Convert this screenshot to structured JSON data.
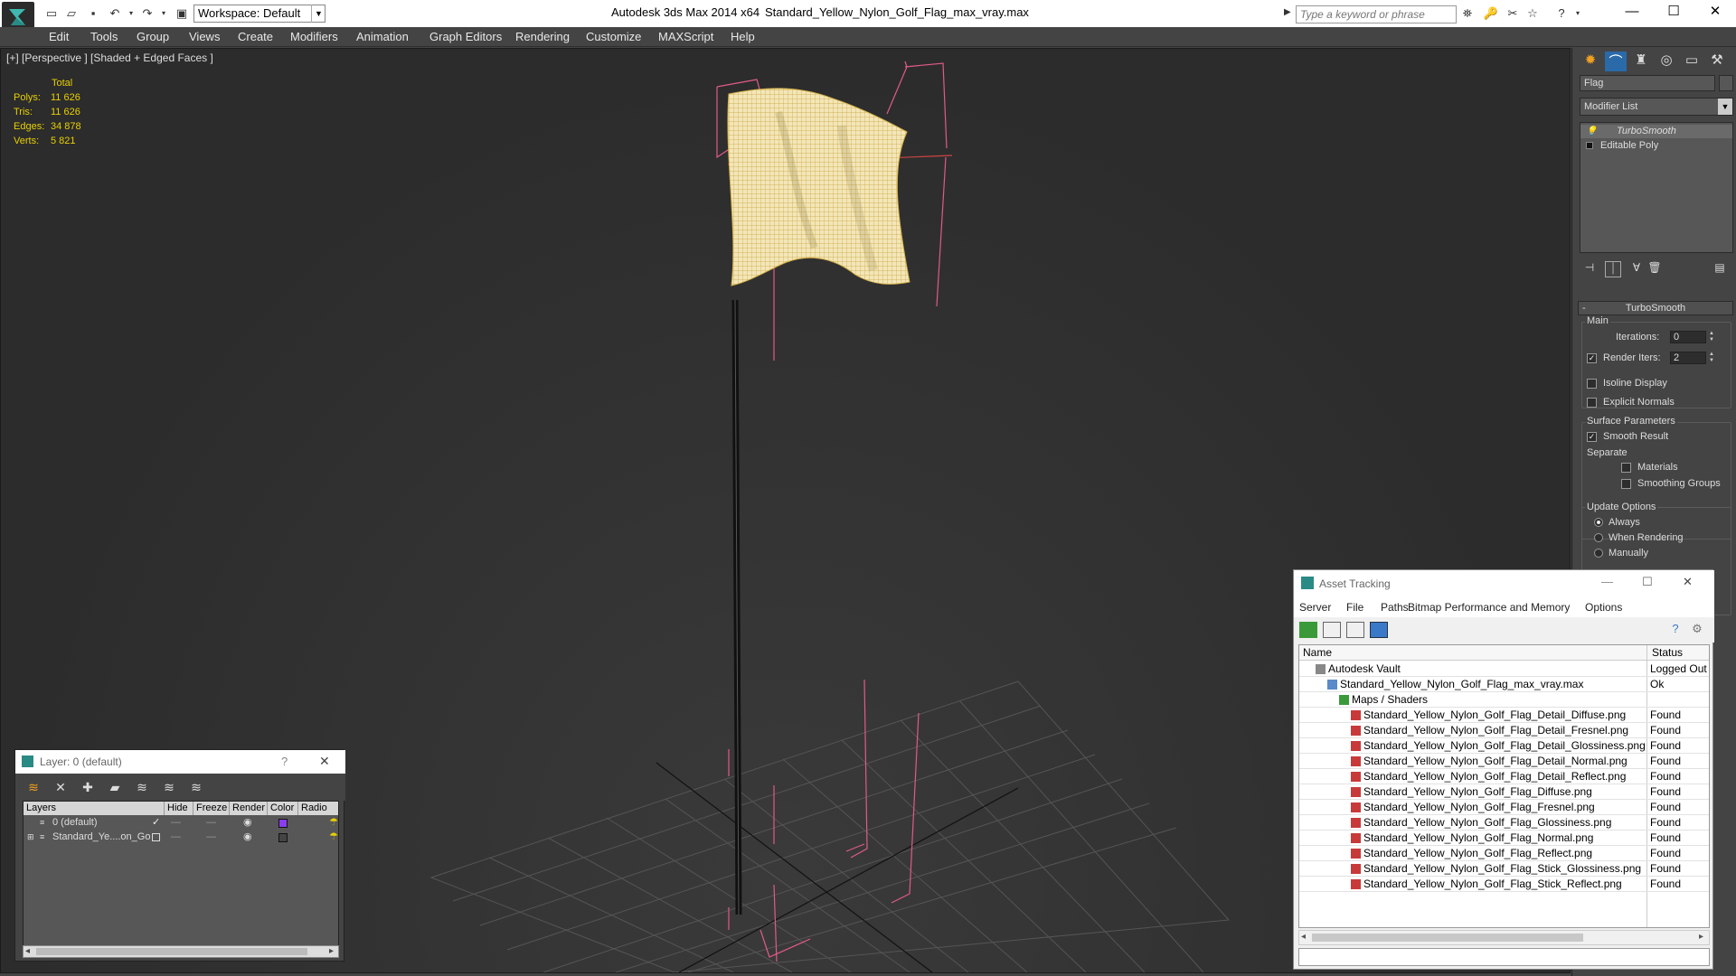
{
  "app": {
    "title": "Autodesk 3ds Max  2014 x64",
    "file": "Standard_Yellow_Nylon_Golf_Flag_max_vray.max",
    "workspace": "Workspace: Default",
    "search_placeholder": "Type a keyword or phrase"
  },
  "menu": [
    "Edit",
    "Tools",
    "Group",
    "Views",
    "Create",
    "Modifiers",
    "Animation",
    "Graph Editors",
    "Rendering",
    "Customize",
    "MAXScript",
    "Help"
  ],
  "viewport": {
    "label": "[+] [Perspective ] [Shaded + Edged Faces ]",
    "stats_header": "Total",
    "stats": [
      {
        "label": "Polys:",
        "value": "11 626"
      },
      {
        "label": "Tris:",
        "value": "11 626"
      },
      {
        "label": "Edges:",
        "value": "34 878"
      },
      {
        "label": "Verts:",
        "value": "5 821"
      }
    ]
  },
  "command_panel": {
    "object_name": "Flag",
    "modifier_list": "Modifier List",
    "stack": [
      "TurboSmooth",
      "Editable Poly"
    ],
    "rollout_title": "TurboSmooth",
    "main_label": "Main",
    "iterations_label": "Iterations:",
    "iterations_value": "0",
    "render_iters_label": "Render Iters:",
    "render_iters_value": "2",
    "isoline": "Isoline Display",
    "explicit_normals": "Explicit Normals",
    "surface_params": "Surface Parameters",
    "smooth_result": "Smooth Result",
    "separate": "Separate",
    "materials": "Materials",
    "smoothing_groups": "Smoothing Groups",
    "update_options": "Update Options",
    "always": "Always",
    "when_rendering": "When Rendering",
    "manually": "Manually"
  },
  "asset_tracking": {
    "title": "Asset Tracking",
    "menu": [
      "Server",
      "File",
      "Paths",
      "Bitmap Performance and Memory",
      "Options"
    ],
    "columns": [
      "Name",
      "Status"
    ],
    "rows": [
      {
        "name": "Autodesk Vault",
        "status": "Logged Out",
        "level": 0,
        "icon": "vault-icon"
      },
      {
        "name": "Standard_Yellow_Nylon_Golf_Flag_max_vray.max",
        "status": "Ok",
        "level": 1,
        "icon": "max-file-icon"
      },
      {
        "name": "Maps / Shaders",
        "status": "",
        "level": 2,
        "icon": "maps-icon"
      },
      {
        "name": "Standard_Yellow_Nylon_Golf_Flag_Detail_Diffuse.png",
        "status": "Found",
        "level": 3,
        "icon": "png-icon"
      },
      {
        "name": "Standard_Yellow_Nylon_Golf_Flag_Detail_Fresnel.png",
        "status": "Found",
        "level": 3,
        "icon": "png-icon"
      },
      {
        "name": "Standard_Yellow_Nylon_Golf_Flag_Detail_Glossiness.png",
        "status": "Found",
        "level": 3,
        "icon": "png-icon"
      },
      {
        "name": "Standard_Yellow_Nylon_Golf_Flag_Detail_Normal.png",
        "status": "Found",
        "level": 3,
        "icon": "png-icon"
      },
      {
        "name": "Standard_Yellow_Nylon_Golf_Flag_Detail_Reflect.png",
        "status": "Found",
        "level": 3,
        "icon": "png-icon"
      },
      {
        "name": "Standard_Yellow_Nylon_Golf_Flag_Diffuse.png",
        "status": "Found",
        "level": 3,
        "icon": "png-icon"
      },
      {
        "name": "Standard_Yellow_Nylon_Golf_Flag_Fresnel.png",
        "status": "Found",
        "level": 3,
        "icon": "png-icon"
      },
      {
        "name": "Standard_Yellow_Nylon_Golf_Flag_Glossiness.png",
        "status": "Found",
        "level": 3,
        "icon": "png-icon"
      },
      {
        "name": "Standard_Yellow_Nylon_Golf_Flag_Normal.png",
        "status": "Found",
        "level": 3,
        "icon": "png-icon"
      },
      {
        "name": "Standard_Yellow_Nylon_Golf_Flag_Reflect.png",
        "status": "Found",
        "level": 3,
        "icon": "png-icon"
      },
      {
        "name": "Standard_Yellow_Nylon_Golf_Flag_Stick_Glossiness.png",
        "status": "Found",
        "level": 3,
        "icon": "png-icon"
      },
      {
        "name": "Standard_Yellow_Nylon_Golf_Flag_Stick_Reflect.png",
        "status": "Found",
        "level": 3,
        "icon": "png-icon"
      }
    ]
  },
  "layer_explorer": {
    "title": "Layer: 0 (default)",
    "help": "?",
    "columns": [
      "Layers",
      "Hide",
      "Freeze",
      "Render",
      "Color",
      "Radio"
    ],
    "rows": [
      {
        "name": "0 (default)",
        "color": "#8a3df0"
      },
      {
        "name": "Standard_Ye....on_Go",
        "color": "#444444"
      }
    ]
  },
  "colors": {
    "stats_yellow": "#e8d000",
    "selection_pink": "#e05a8a",
    "flag_wire": "#d8c36a"
  }
}
